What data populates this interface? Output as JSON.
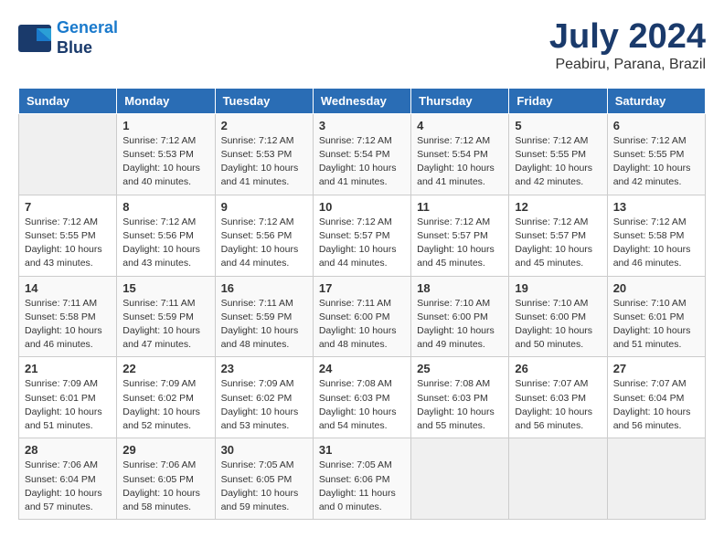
{
  "logo": {
    "line1": "General",
    "line2": "Blue"
  },
  "title": "July 2024",
  "location": "Peabiru, Parana, Brazil",
  "headers": [
    "Sunday",
    "Monday",
    "Tuesday",
    "Wednesday",
    "Thursday",
    "Friday",
    "Saturday"
  ],
  "weeks": [
    [
      {
        "day": "",
        "info": ""
      },
      {
        "day": "1",
        "info": "Sunrise: 7:12 AM\nSunset: 5:53 PM\nDaylight: 10 hours\nand 40 minutes."
      },
      {
        "day": "2",
        "info": "Sunrise: 7:12 AM\nSunset: 5:53 PM\nDaylight: 10 hours\nand 41 minutes."
      },
      {
        "day": "3",
        "info": "Sunrise: 7:12 AM\nSunset: 5:54 PM\nDaylight: 10 hours\nand 41 minutes."
      },
      {
        "day": "4",
        "info": "Sunrise: 7:12 AM\nSunset: 5:54 PM\nDaylight: 10 hours\nand 41 minutes."
      },
      {
        "day": "5",
        "info": "Sunrise: 7:12 AM\nSunset: 5:55 PM\nDaylight: 10 hours\nand 42 minutes."
      },
      {
        "day": "6",
        "info": "Sunrise: 7:12 AM\nSunset: 5:55 PM\nDaylight: 10 hours\nand 42 minutes."
      }
    ],
    [
      {
        "day": "7",
        "info": "Sunrise: 7:12 AM\nSunset: 5:55 PM\nDaylight: 10 hours\nand 43 minutes."
      },
      {
        "day": "8",
        "info": "Sunrise: 7:12 AM\nSunset: 5:56 PM\nDaylight: 10 hours\nand 43 minutes."
      },
      {
        "day": "9",
        "info": "Sunrise: 7:12 AM\nSunset: 5:56 PM\nDaylight: 10 hours\nand 44 minutes."
      },
      {
        "day": "10",
        "info": "Sunrise: 7:12 AM\nSunset: 5:57 PM\nDaylight: 10 hours\nand 44 minutes."
      },
      {
        "day": "11",
        "info": "Sunrise: 7:12 AM\nSunset: 5:57 PM\nDaylight: 10 hours\nand 45 minutes."
      },
      {
        "day": "12",
        "info": "Sunrise: 7:12 AM\nSunset: 5:57 PM\nDaylight: 10 hours\nand 45 minutes."
      },
      {
        "day": "13",
        "info": "Sunrise: 7:12 AM\nSunset: 5:58 PM\nDaylight: 10 hours\nand 46 minutes."
      }
    ],
    [
      {
        "day": "14",
        "info": "Sunrise: 7:11 AM\nSunset: 5:58 PM\nDaylight: 10 hours\nand 46 minutes."
      },
      {
        "day": "15",
        "info": "Sunrise: 7:11 AM\nSunset: 5:59 PM\nDaylight: 10 hours\nand 47 minutes."
      },
      {
        "day": "16",
        "info": "Sunrise: 7:11 AM\nSunset: 5:59 PM\nDaylight: 10 hours\nand 48 minutes."
      },
      {
        "day": "17",
        "info": "Sunrise: 7:11 AM\nSunset: 6:00 PM\nDaylight: 10 hours\nand 48 minutes."
      },
      {
        "day": "18",
        "info": "Sunrise: 7:10 AM\nSunset: 6:00 PM\nDaylight: 10 hours\nand 49 minutes."
      },
      {
        "day": "19",
        "info": "Sunrise: 7:10 AM\nSunset: 6:00 PM\nDaylight: 10 hours\nand 50 minutes."
      },
      {
        "day": "20",
        "info": "Sunrise: 7:10 AM\nSunset: 6:01 PM\nDaylight: 10 hours\nand 51 minutes."
      }
    ],
    [
      {
        "day": "21",
        "info": "Sunrise: 7:09 AM\nSunset: 6:01 PM\nDaylight: 10 hours\nand 51 minutes."
      },
      {
        "day": "22",
        "info": "Sunrise: 7:09 AM\nSunset: 6:02 PM\nDaylight: 10 hours\nand 52 minutes."
      },
      {
        "day": "23",
        "info": "Sunrise: 7:09 AM\nSunset: 6:02 PM\nDaylight: 10 hours\nand 53 minutes."
      },
      {
        "day": "24",
        "info": "Sunrise: 7:08 AM\nSunset: 6:03 PM\nDaylight: 10 hours\nand 54 minutes."
      },
      {
        "day": "25",
        "info": "Sunrise: 7:08 AM\nSunset: 6:03 PM\nDaylight: 10 hours\nand 55 minutes."
      },
      {
        "day": "26",
        "info": "Sunrise: 7:07 AM\nSunset: 6:03 PM\nDaylight: 10 hours\nand 56 minutes."
      },
      {
        "day": "27",
        "info": "Sunrise: 7:07 AM\nSunset: 6:04 PM\nDaylight: 10 hours\nand 56 minutes."
      }
    ],
    [
      {
        "day": "28",
        "info": "Sunrise: 7:06 AM\nSunset: 6:04 PM\nDaylight: 10 hours\nand 57 minutes."
      },
      {
        "day": "29",
        "info": "Sunrise: 7:06 AM\nSunset: 6:05 PM\nDaylight: 10 hours\nand 58 minutes."
      },
      {
        "day": "30",
        "info": "Sunrise: 7:05 AM\nSunset: 6:05 PM\nDaylight: 10 hours\nand 59 minutes."
      },
      {
        "day": "31",
        "info": "Sunrise: 7:05 AM\nSunset: 6:06 PM\nDaylight: 11 hours\nand 0 minutes."
      },
      {
        "day": "",
        "info": ""
      },
      {
        "day": "",
        "info": ""
      },
      {
        "day": "",
        "info": ""
      }
    ]
  ]
}
